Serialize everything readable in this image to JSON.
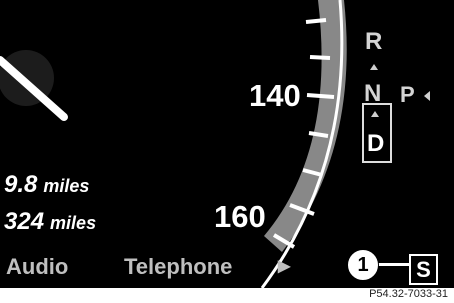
{
  "speedometer": {
    "speed_labels": [
      "140",
      "160"
    ],
    "needle_color": "#ffffff",
    "band_color": "#888888"
  },
  "trip": {
    "line1": {
      "value": "9.8",
      "unit": "miles"
    },
    "line2": {
      "value": "324",
      "unit": "miles"
    }
  },
  "menu": {
    "audio_label": "Audio",
    "telephone_label": "Telephone",
    "arrow_icon": "right-triangle-icon"
  },
  "transmission": {
    "gears": [
      "R",
      "N",
      "P",
      "D"
    ],
    "selected": "D"
  },
  "mode_indicator": {
    "label": "S",
    "callout_number": "1"
  },
  "caption": "P54.32-7033-31"
}
